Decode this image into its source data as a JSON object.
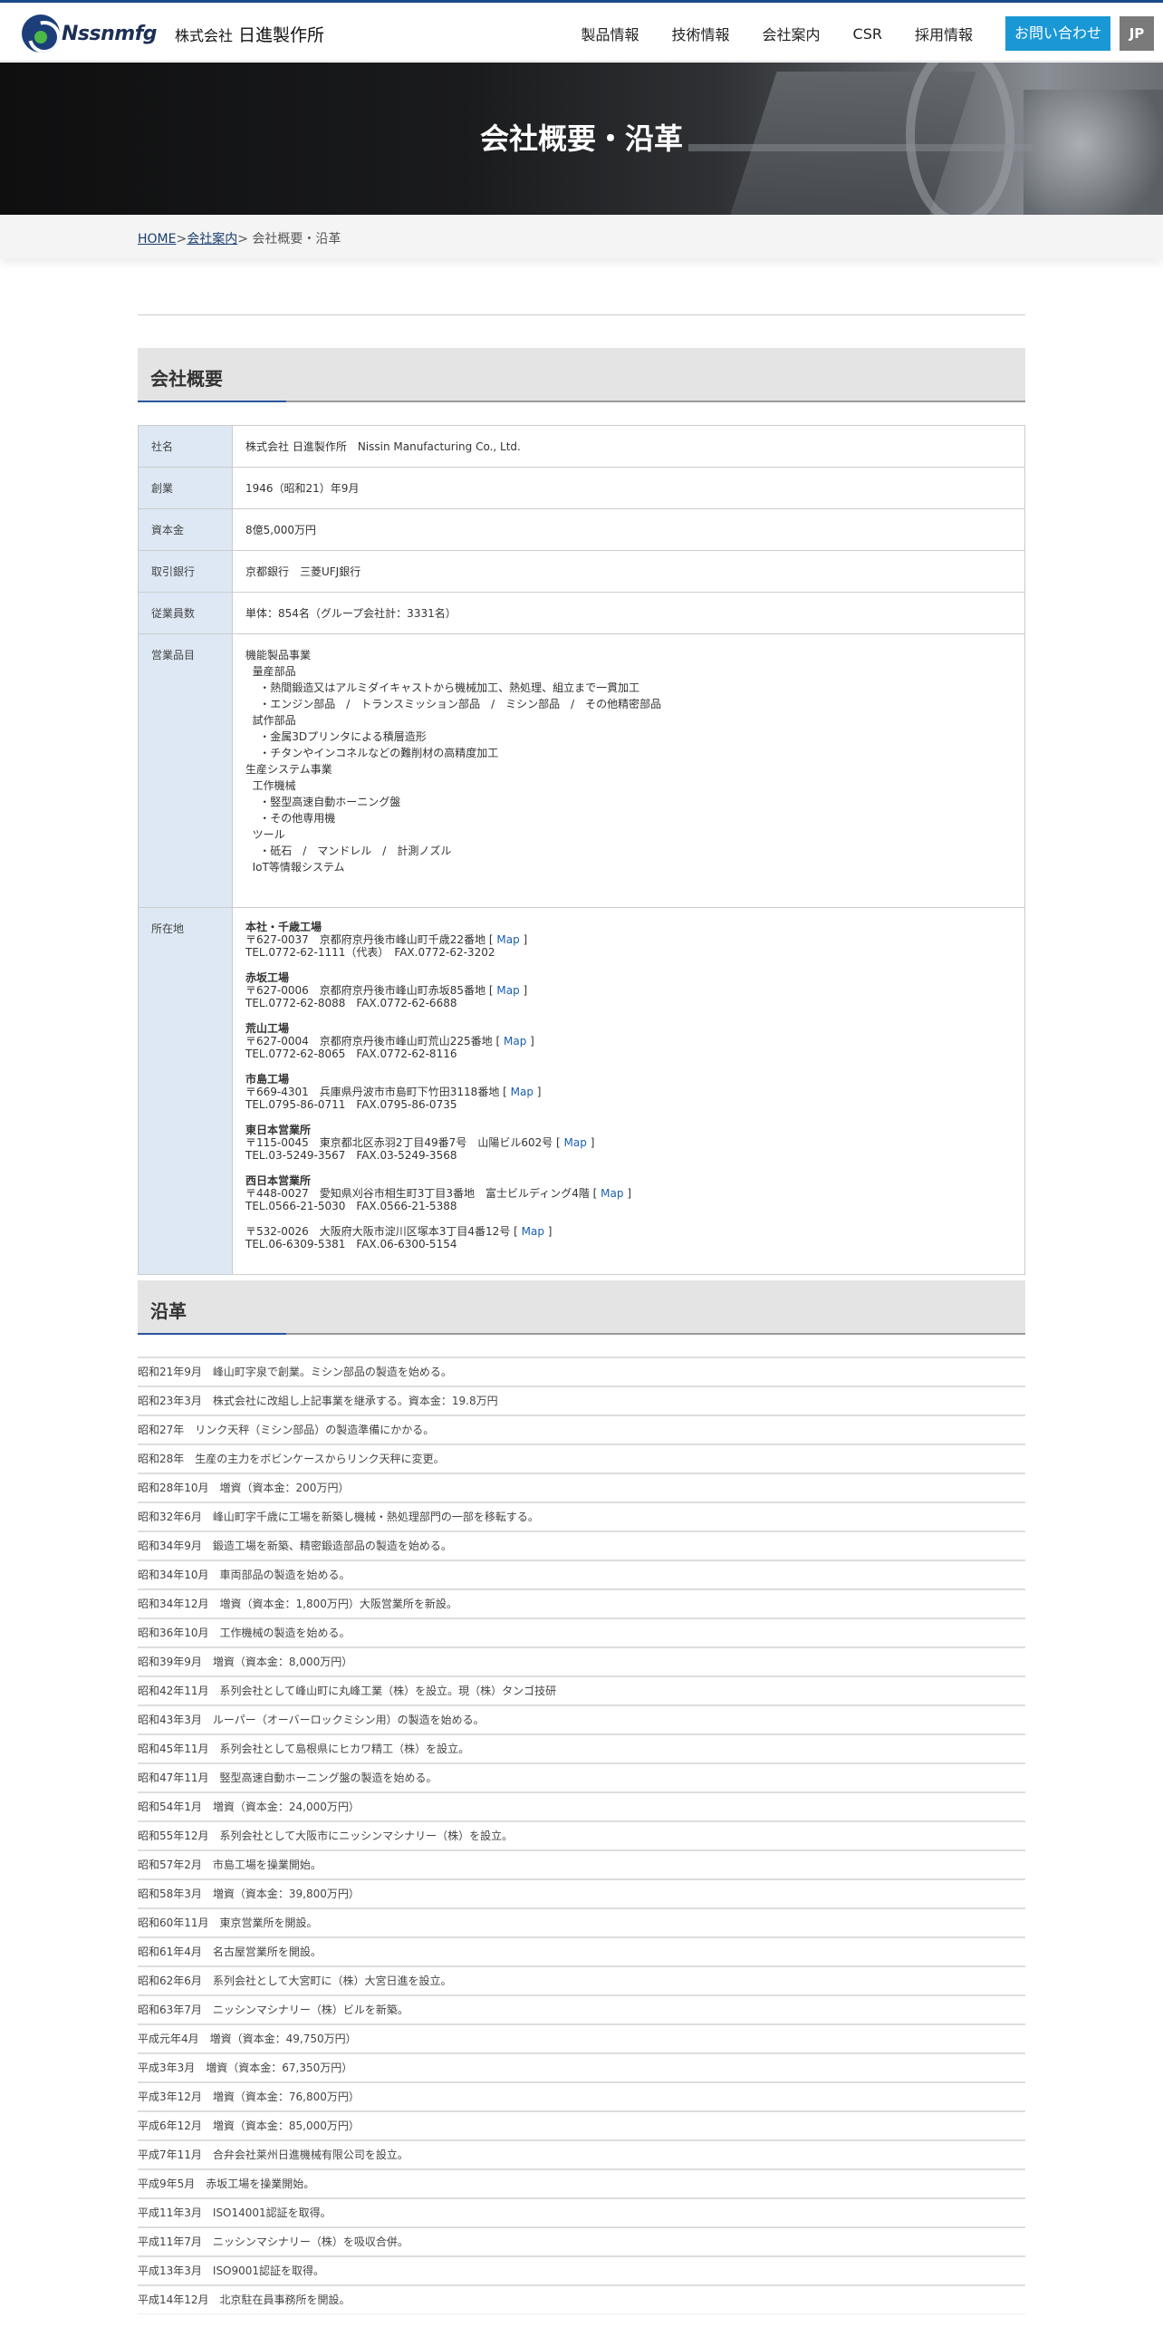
{
  "header": {
    "logo_word": "Nssnmfg",
    "company_prefix": "株式会社",
    "company_name": "日進製作所",
    "nav": [
      "製品情報",
      "技術情報",
      "会社案内",
      "CSR",
      "採用情報"
    ],
    "contact": "お問い合わせ",
    "lang": "JP"
  },
  "hero": {
    "title": "会社概要・沿革"
  },
  "breadcrumb": {
    "home": "HOME",
    "sep1": ">",
    "company": "会社案内",
    "sep2": ">",
    "current": "会社概要・沿革"
  },
  "overview": {
    "heading": "会社概要",
    "rows": [
      {
        "label": "社名",
        "value": "株式会社 日進製作所　Nissin Manufacturing Co., Ltd."
      },
      {
        "label": "創業",
        "value": "1946（昭和21）年9月"
      },
      {
        "label": "資本金",
        "value": "8億5,000万円"
      },
      {
        "label": "取引銀行",
        "value": "京都銀行　三菱UFJ銀行"
      },
      {
        "label": "従業員数",
        "value": "単体：854名（グループ会社計：3331名）"
      }
    ],
    "products_label": "営業品目",
    "products": [
      "機能製品事業",
      "  量産部品",
      "    ・熱間鍛造又はアルミダイキャストから機械加工、熱処理、組立まで一貫加工",
      "    ・エンジン部品　/　トランスミッション部品　/　ミシン部品　/　その他精密部品",
      "  試作部品",
      "    ・金属3Dプリンタによる積層造形",
      "    ・チタンやインコネルなどの難削材の高精度加工",
      "生産システム事業",
      "  工作機械",
      "    ・竪型高速自動ホーニング盤",
      "    ・その他専用機",
      "  ツール",
      "    ・砥石　/　マンドレル　/　計測ノズル",
      "  IoT等情報システム"
    ],
    "locations_label": "所在地",
    "map_text": "Map",
    "locations": [
      {
        "name": "本社・千歳工場",
        "address": "〒627-0037　京都府京丹後市峰山町千歳22番地 [",
        "tel": "TEL.0772-62-1111（代表）　FAX.0772-62-3202"
      },
      {
        "name": "赤坂工場",
        "address": "〒627-0006　京都府京丹後市峰山町赤坂85番地 [",
        "tel": "TEL.0772-62-8088　FAX.0772-62-6688"
      },
      {
        "name": "荒山工場",
        "address": "〒627-0004　京都府京丹後市峰山町荒山225番地 [",
        "tel": "TEL.0772-62-8065　FAX.0772-62-8116"
      },
      {
        "name": "市島工場",
        "address": "〒669-4301　兵庫県丹波市市島町下竹田3118番地 [",
        "tel": "TEL.0795-86-0711　FAX.0795-86-0735"
      },
      {
        "name": "東日本営業所",
        "address": "〒115-0045　東京都北区赤羽2丁目49番7号　山陽ビル602号 [",
        "tel": "TEL.03-5249-3567　FAX.03-5249-3568"
      },
      {
        "name": "西日本営業所",
        "address": "〒448-0027　愛知県刈谷市相生町3丁目3番地　富士ビルディング4階 [",
        "tel": "TEL.0566-21-5030　FAX.0566-21-5388"
      },
      {
        "name": "",
        "address": "〒532-0026　大阪府大阪市淀川区塚本3丁目4番12号 [",
        "tel": "TEL.06-6309-5381　FAX.06-6300-5154"
      }
    ]
  },
  "history": {
    "heading": "沿革",
    "items": [
      "昭和21年9月　峰山町字泉で創業。ミシン部品の製造を始める。",
      "昭和23年3月　株式会社に改組し上記事業を継承する。資本金：19.8万円",
      "昭和27年　リンク天秤（ミシン部品）の製造準備にかかる。",
      "昭和28年　生産の主力をボビンケースからリンク天秤に変更。",
      "昭和28年10月　増資（資本金：200万円）",
      "昭和32年6月　峰山町字千歳に工場を新築し機械・熱処理部門の一部を移転する。",
      "昭和34年9月　鍛造工場を新築、精密鍛造部品の製造を始める。",
      "昭和34年10月　車両部品の製造を始める。",
      "昭和34年12月　増資（資本金：1,800万円）大阪営業所を新設。",
      "昭和36年10月　工作機械の製造を始める。",
      "昭和39年9月　増資（資本金：8,000万円）",
      "昭和42年11月　系列会社として峰山町に丸峰工業（株）を設立。現（株）タンゴ技研",
      "昭和43年3月　ルーパー（オーバーロックミシン用）の製造を始める。",
      "昭和45年11月　系列会社として島根県にヒカワ精工（株）を設立。",
      "昭和47年11月　竪型高速自動ホーニング盤の製造を始める。",
      "昭和54年1月　増資（資本金：24,000万円）",
      "昭和55年12月　系列会社として大阪市にニッシンマシナリー（株）を設立。",
      "昭和57年2月　市島工場を操業開始。",
      "昭和58年3月　増資（資本金：39,800万円）",
      "昭和60年11月　東京営業所を開設。",
      "昭和61年4月　名古屋営業所を開設。",
      "昭和62年6月　系列会社として大宮町に（株）大宮日進を設立。",
      "昭和63年7月　ニッシンマシナリー（株）ビルを新築。",
      "平成元年4月　増資（資本金：49,750万円）",
      "平成3年3月　増資（資本金：67,350万円）",
      "平成3年12月　増資（資本金：76,800万円）",
      "平成6年12月　増資（資本金：85,000万円）",
      "平成7年11月　合弁会社莱州日進機械有限公司を設立。",
      "平成9年5月　赤坂工場を操業開始。",
      "平成11年3月　ISO14001認証を取得。",
      "平成11年7月　ニッシンマシナリー（株）を吸収合併。",
      "平成13年3月　ISO9001認証を取得。",
      "平成14年12月　北京駐在員事務所を開設。"
    ]
  }
}
